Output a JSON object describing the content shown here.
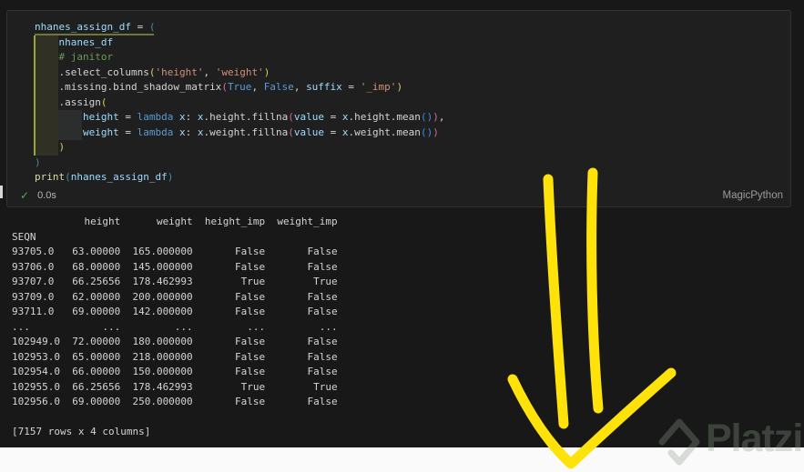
{
  "palette": {
    "variable": "#9CDCFE",
    "plain": "#D4D4D4",
    "keyword": "#569CD6",
    "string": "#CE9178",
    "comment": "#6A9955",
    "builtin": "#DCDCAA",
    "bracket1": "#35939B",
    "bracket2": "#DBCE57",
    "bracket3": "#D6679E",
    "bracket4": "#3B8EEA",
    "check_green": "#4FAE52",
    "arrow_yellow": "#FFE20A"
  },
  "cell": {
    "status": {
      "check": "✓",
      "duration": "0.0s",
      "language": "MagicPython"
    },
    "code_lines": [
      [
        [
          "nhanes_assign_df",
          "variable"
        ],
        [
          " = ",
          "plain"
        ],
        [
          "(",
          "bracket1"
        ]
      ],
      [
        [
          "    ",
          "plain"
        ],
        [
          "nhanes_df",
          "variable"
        ]
      ],
      [
        [
          "    ",
          "plain"
        ],
        [
          "# janitor",
          "comment"
        ]
      ],
      [
        [
          "    ",
          "plain"
        ],
        [
          ".select_columns",
          "plain"
        ],
        [
          "(",
          "bracket2"
        ],
        [
          "'height'",
          "string"
        ],
        [
          ", ",
          "plain"
        ],
        [
          "'weight'",
          "string"
        ],
        [
          ")",
          "bracket2"
        ]
      ],
      [
        [
          "    ",
          "plain"
        ],
        [
          ".missing.bind_shadow_matrix",
          "plain"
        ],
        [
          "(",
          "bracket3"
        ],
        [
          "True",
          "keyword"
        ],
        [
          ", ",
          "plain"
        ],
        [
          "False",
          "keyword"
        ],
        [
          ", ",
          "plain"
        ],
        [
          "suffix",
          "variable"
        ],
        [
          " = ",
          "plain"
        ],
        [
          "'_imp'",
          "string"
        ],
        [
          ")",
          "bracket2"
        ]
      ],
      [
        [
          "    ",
          "plain"
        ],
        [
          ".assign",
          "plain"
        ],
        [
          "(",
          "bracket2"
        ]
      ],
      [
        [
          "        ",
          "plain"
        ],
        [
          "height",
          "variable"
        ],
        [
          " = ",
          "plain"
        ],
        [
          "lambda",
          "keyword"
        ],
        [
          " ",
          "plain"
        ],
        [
          "x",
          "variable"
        ],
        [
          ": ",
          "plain"
        ],
        [
          "x",
          "variable"
        ],
        [
          ".height.fillna",
          "plain"
        ],
        [
          "(",
          "bracket3"
        ],
        [
          "value",
          "variable"
        ],
        [
          " = ",
          "plain"
        ],
        [
          "x",
          "variable"
        ],
        [
          ".height.mean",
          "plain"
        ],
        [
          "(",
          "bracket4"
        ],
        [
          ")",
          "bracket4"
        ],
        [
          ")",
          "bracket3"
        ],
        [
          ",",
          "plain"
        ]
      ],
      [
        [
          "        ",
          "plain"
        ],
        [
          "weight",
          "variable"
        ],
        [
          " = ",
          "plain"
        ],
        [
          "lambda",
          "keyword"
        ],
        [
          " ",
          "plain"
        ],
        [
          "x",
          "variable"
        ],
        [
          ": ",
          "plain"
        ],
        [
          "x",
          "variable"
        ],
        [
          ".weight.fillna",
          "plain"
        ],
        [
          "(",
          "bracket3"
        ],
        [
          "value",
          "variable"
        ],
        [
          " = ",
          "plain"
        ],
        [
          "x",
          "variable"
        ],
        [
          ".weight.mean",
          "plain"
        ],
        [
          "(",
          "bracket4"
        ],
        [
          ")",
          "bracket4"
        ],
        [
          ")",
          "bracket3"
        ]
      ],
      [
        [
          "    ",
          "plain"
        ],
        [
          ")",
          "bracket2"
        ]
      ],
      [
        [
          ")",
          "bracket1"
        ]
      ],
      [
        [
          "print",
          "builtin"
        ],
        [
          "(",
          "bracket1"
        ],
        [
          "nhanes_assign_df",
          "variable"
        ],
        [
          ")",
          "bracket1"
        ]
      ]
    ]
  },
  "output": {
    "index_name": "SEQN",
    "columns": [
      "height",
      "weight",
      "height_imp",
      "weight_imp"
    ],
    "rows": [
      [
        "93705.0",
        "63.00000",
        "165.000000",
        "False",
        "False"
      ],
      [
        "93706.0",
        "68.00000",
        "145.000000",
        "False",
        "False"
      ],
      [
        "93707.0",
        "66.25656",
        "178.462993",
        "True",
        "True"
      ],
      [
        "93709.0",
        "62.00000",
        "200.000000",
        "False",
        "False"
      ],
      [
        "93711.0",
        "69.00000",
        "142.000000",
        "False",
        "False"
      ],
      [
        "...",
        "...",
        "...",
        "...",
        "..."
      ],
      [
        "102949.0",
        "72.00000",
        "180.000000",
        "False",
        "False"
      ],
      [
        "102953.0",
        "65.00000",
        "218.000000",
        "False",
        "False"
      ],
      [
        "102954.0",
        "66.00000",
        "150.000000",
        "False",
        "False"
      ],
      [
        "102955.0",
        "66.25656",
        "178.462993",
        "True",
        "True"
      ],
      [
        "102956.0",
        "69.00000",
        "250.000000",
        "False",
        "False"
      ]
    ],
    "footer": "[7157 rows x 4 columns]"
  },
  "annotation": {
    "paths": [
      "M 602 197 C 605 270, 611 360, 619 466",
      "M 651 190 C 648 270, 650 370, 657 449",
      "M 563 417 Q 592 478, 627 510 Q 678 462, 737 410"
    ],
    "stroke_width": 11
  },
  "watermark": {
    "text": "Platzi"
  }
}
